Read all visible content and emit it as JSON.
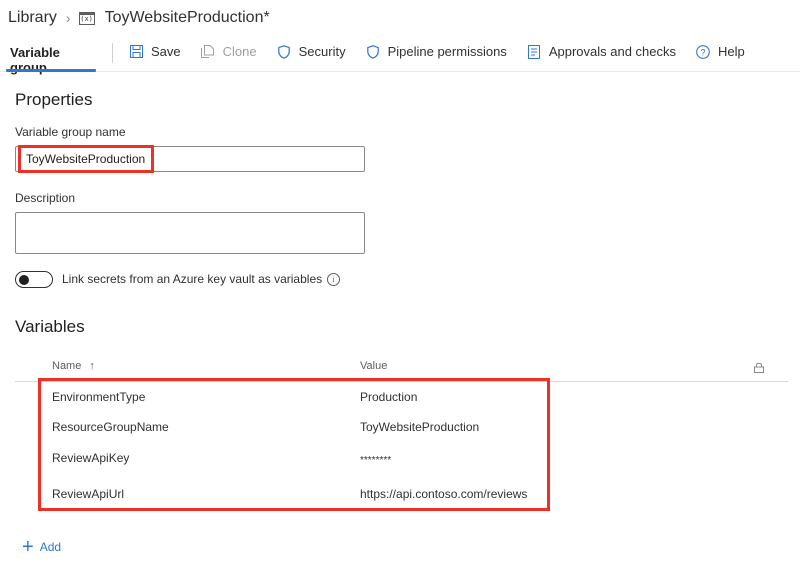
{
  "breadcrumb": {
    "root": "Library",
    "separator": "›",
    "icon": "variable-group-icon",
    "icon_text": "(x)",
    "title": "ToyWebsiteProduction*"
  },
  "toolbar": {
    "active_tab": "Variable group",
    "buttons": [
      {
        "label": "Save",
        "icon": "save-icon",
        "enabled": true
      },
      {
        "label": "Clone",
        "icon": "clone-icon",
        "enabled": false
      },
      {
        "label": "Security",
        "icon": "shield-icon",
        "enabled": true
      },
      {
        "label": "Pipeline permissions",
        "icon": "shield-icon",
        "enabled": true
      },
      {
        "label": "Approvals and checks",
        "icon": "checklist-icon",
        "enabled": true
      },
      {
        "label": "Help",
        "icon": "help-icon",
        "enabled": true
      }
    ]
  },
  "properties": {
    "title": "Properties",
    "name_label": "Variable group name",
    "name_value": "ToyWebsiteProduction",
    "description_label": "Description",
    "description_value": "",
    "keyvault_toggle_label": "Link secrets from an Azure key vault as variables",
    "keyvault_toggle_on": false
  },
  "variables": {
    "title": "Variables",
    "columns": {
      "name": "Name",
      "name_sort": "↑",
      "value": "Value"
    },
    "rows": [
      {
        "name": "EnvironmentType",
        "value": "Production"
      },
      {
        "name": "ResourceGroupName",
        "value": "ToyWebsiteProduction"
      },
      {
        "name": "ReviewApiKey",
        "value": "********"
      },
      {
        "name": "ReviewApiUrl",
        "value": "https://api.contoso.com/reviews"
      }
    ],
    "add_label": "Add"
  },
  "colors": {
    "accent": "#2f77d1",
    "highlight": "#ee3127",
    "text": "#323130"
  }
}
